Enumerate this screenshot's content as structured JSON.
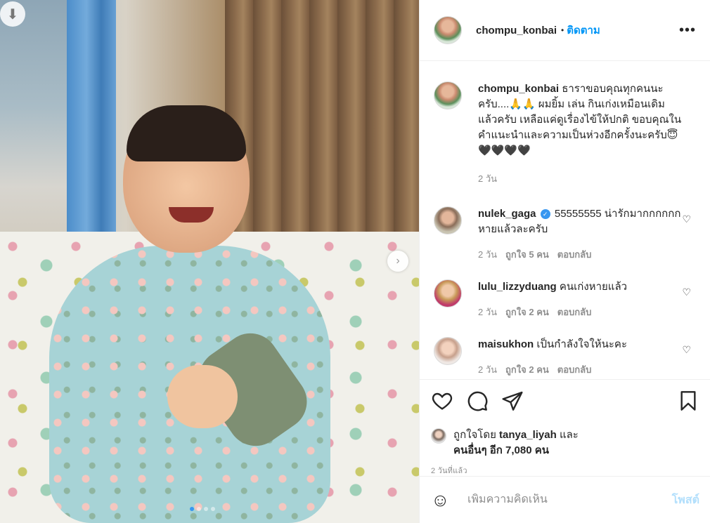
{
  "media": {
    "download_icon": "arrow-down-icon",
    "next_icon": "chevron-right-icon",
    "carousel_dots": 4,
    "active_dot": 0
  },
  "header": {
    "username": "chompu_konbai",
    "separator": "•",
    "follow_label": "ติดตาม",
    "more_label": "•••"
  },
  "caption": {
    "username": "chompu_konbai",
    "text": "ธาราขอบคุณทุกคนนะครับ....🙏🙏 ผมยิ้ม เล่น กินเก่งเหมือนเดิมแล้วครับ เหลือแค่ดูเรื่องไข้ให้ปกติ ขอบคุณในคำแนะนำและความเป็นห่วงอีกครั้งนะครับ😇🖤🖤🖤🖤",
    "time": "2 วัน"
  },
  "comments": [
    {
      "username": "nulek_gaga",
      "verified": true,
      "text": "55555555 น่ารักมากกกกกก หายแล้วละครับ",
      "time": "2 วัน",
      "likes": "ถูกใจ 5 คน",
      "reply": "ตอบกลับ"
    },
    {
      "username": "lulu_lizzyduang",
      "verified": false,
      "text": "คนเก่งหายแล้ว",
      "time": "2 วัน",
      "likes": "ถูกใจ 2 คน",
      "reply": "ตอบกลับ"
    },
    {
      "username": "maisukhon",
      "verified": false,
      "text": "เป็นกำลังใจให้นะคะ",
      "time": "2 วัน",
      "likes": "ถูกใจ 2 คน",
      "reply": "ตอบกลับ"
    }
  ],
  "actions": {
    "like_icon": "heart-icon",
    "comment_icon": "comment-icon",
    "share_icon": "send-icon",
    "save_icon": "bookmark-icon"
  },
  "likes": {
    "prefix": "ถูกใจโดย",
    "user": "tanya_liyah",
    "conj": "และ",
    "others": "คนอื่นๆ อีก 7,080 คน"
  },
  "posted": "2 วันที่แล้ว",
  "add_comment": {
    "emoji_icon": "smiley-icon",
    "placeholder": "เพิ่มความคิดเห็น",
    "post_label": "โพสต์"
  },
  "colors": {
    "accent": "#0095f6",
    "post_disabled": "#b2dffc",
    "muted": "#8e8e8e",
    "text": "#262626"
  }
}
